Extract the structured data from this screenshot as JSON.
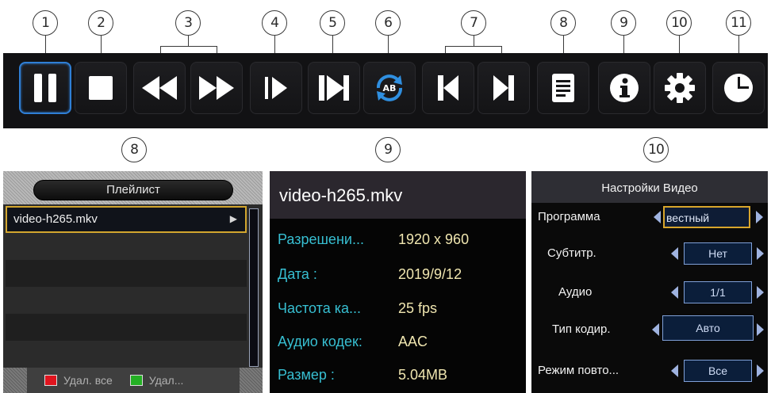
{
  "callouts_top": [
    "1",
    "2",
    "3",
    "4",
    "5",
    "6",
    "7",
    "8",
    "9",
    "10",
    "11"
  ],
  "callouts_panels": [
    "8",
    "9",
    "10"
  ],
  "toolbar": {
    "buttons": [
      {
        "name": "pause",
        "icon": "pause-icon"
      },
      {
        "name": "stop",
        "icon": "stop-icon"
      },
      {
        "name": "rewind",
        "icon": "rewind-icon"
      },
      {
        "name": "fast-forward",
        "icon": "fast-forward-icon"
      },
      {
        "name": "step-forward",
        "icon": "step-forward-icon"
      },
      {
        "name": "next-frame",
        "icon": "next-frame-icon"
      },
      {
        "name": "repeat-ab",
        "icon": "repeat-ab-icon",
        "text": "AB"
      },
      {
        "name": "previous",
        "icon": "skip-previous-icon"
      },
      {
        "name": "next",
        "icon": "skip-next-icon"
      },
      {
        "name": "playlist",
        "icon": "playlist-icon"
      },
      {
        "name": "info",
        "icon": "info-icon"
      },
      {
        "name": "settings",
        "icon": "gear-icon"
      },
      {
        "name": "time",
        "icon": "clock-icon"
      }
    ],
    "accent": "#2f7fd6"
  },
  "playlist": {
    "title": "Плейлист",
    "items": [
      "video-h265.mkv"
    ],
    "footer": {
      "delete_all": "Удал. все",
      "delete": "Удал..."
    }
  },
  "info": {
    "filename": "video-h265.mkv",
    "rows": [
      {
        "label": "Разрешени...",
        "value": "1920 x 960"
      },
      {
        "label": "Дата :",
        "value": "2019/9/12"
      },
      {
        "label": "Частота ка...",
        "value": "25 fps"
      },
      {
        "label": "Аудио кодек:",
        "value": "AAC"
      },
      {
        "label": "Размер :",
        "value": "5.04MB"
      }
    ]
  },
  "settings": {
    "title": "Настройки Видео",
    "rows": [
      {
        "label": "Программа",
        "value": "вестный"
      },
      {
        "label": "Субтитр.",
        "value": "Нет"
      },
      {
        "label": "Аудио",
        "value": "1/1"
      },
      {
        "label": "Тип кодир.",
        "value": "Авто"
      },
      {
        "label": "Режим повто...",
        "value": "Все"
      }
    ],
    "focus_color": "#d7a52c"
  }
}
